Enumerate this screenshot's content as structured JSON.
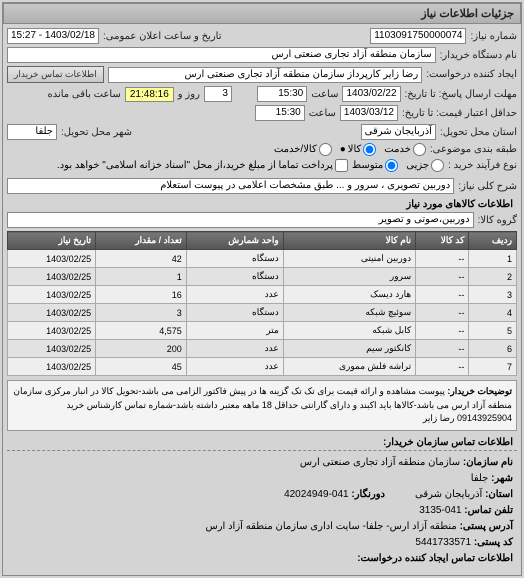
{
  "panel_title": "جزئیات اطلاعات نیاز",
  "fields": {
    "need_no_label": "شماره نیاز:",
    "need_no": "1103091750000074",
    "public_announce_label": "تاریخ و ساعت اعلان عمومی:",
    "public_announce": "1403/02/18 - 15:27",
    "buyer_org_label": "نام دستگاه خریدار:",
    "buyer_org": "سازمان منطقه آزاد تجاری صنعتی ارس",
    "creator_label": "ایجاد کننده درخواست:",
    "creator": "رضا زایر کارپرداز سازمان منطقه آزاد تجاری صنعتی ارس",
    "contact_btn": "اطلاعات تماس خریدار",
    "reply_deadline_label": "مهلت ارسال پاسخ: تا تاریخ:",
    "reply_date": "1403/02/22",
    "time_label": "ساعت",
    "reply_time": "15:30",
    "days_field": "3",
    "days_label": "روز و",
    "timer": "21:48:16",
    "remain_label": "ساعت باقی مانده",
    "price_valid_label": "حداقل اعتبار قیمت: تا تاریخ:",
    "price_date": "1403/03/12",
    "price_time": "15:30",
    "delivery_prov_label": "استان محل تحویل:",
    "delivery_prov": "آذربایجان شرقی",
    "delivery_city_label": "شهر محل تحویل:",
    "delivery_city": "جلفا",
    "budget_row_label": "طبقه بندی موضوعی:",
    "budget_amount": "●",
    "radio_total": "کالا",
    "radio_part": "کالا/خدمت",
    "radio_service": "خدمت",
    "pay_type_label": "نوع فرآیند خرید :",
    "radio_low": "جزیی",
    "radio_mid": "متوسط",
    "hint_text": "پرداخت تماما از مبلغ خرید،از محل \"اسناد خزانه اسلامی\" خواهد بود.",
    "need_desc_label": "شرح کلی نیاز:",
    "need_desc": "دوربین تصویری ، سرور و ... طبق مشخصات اعلامی در پیوست استعلام",
    "goods_section": "اطلاعات کالاهای مورد نیاز",
    "goods_group_label": "گروه کالا:",
    "goods_group": "دوربین،صوتی و تصویر"
  },
  "table": {
    "headers": [
      "ردیف",
      "کد کالا",
      "نام کالا",
      "واحد شمارش",
      "تعداد / مقدار",
      "تاریخ نیاز"
    ],
    "rows": [
      [
        "1",
        "--",
        "دوربین امنیتی",
        "دستگاه",
        "42",
        "1403/02/25"
      ],
      [
        "2",
        "--",
        "سرور",
        "دستگاه",
        "1",
        "1403/02/25"
      ],
      [
        "3",
        "--",
        "هارد دیسک",
        "عدد",
        "16",
        "1403/02/25"
      ],
      [
        "4",
        "--",
        "سوئیچ شبکه",
        "دستگاه",
        "3",
        "1403/02/25"
      ],
      [
        "5",
        "--",
        "کابل شبکه",
        "متر",
        "4,575",
        "1403/02/25"
      ],
      [
        "6",
        "--",
        "کانکتور سیم",
        "عدد",
        "200",
        "1403/02/25"
      ],
      [
        "7",
        "--",
        "تراشه فلش مموری",
        "عدد",
        "45",
        "1403/02/25"
      ]
    ]
  },
  "note": {
    "label": "توضیحات خریدار:",
    "text": "پیوست مشاهده و ارائه قیمت برای تک تک گزینه ها در پیش فاکتور الزامی می باشد-تحویل کالا در انبار مرکزی سازمان منطقه آزاد ارس می باشد-کالاها باید اکبند و دارای گارانتی حداقل 18 ماهه معتبر داشته باشد-شماره تماس کارشناس خرید 09143925904 رضا زایر"
  },
  "contact": {
    "header": "اطلاعات تماس سازمان خریدار:",
    "org_name_label": "نام سازمان:",
    "org_name": "سازمان منطقه آزاد تجاری صنعتی ارس",
    "city_label": "شهر:",
    "city": "جلفا",
    "province_label": "استان:",
    "province": "آذربایجان شرقی",
    "phone_label": "دورنگار:",
    "phone": "041-42024949",
    "fax_label": "تلفن تماس:",
    "fax": "041-3135",
    "addr_label": "آدرس پستی:",
    "addr": "منطقه آزاد ارس- جلفا- سایت اداری سازمان منطقه آزاد ارس",
    "postal_label": "کد پستی:",
    "postal": "5441733571",
    "creator_label": "اطلاعات تماس ایجاد کننده درخواست:"
  }
}
